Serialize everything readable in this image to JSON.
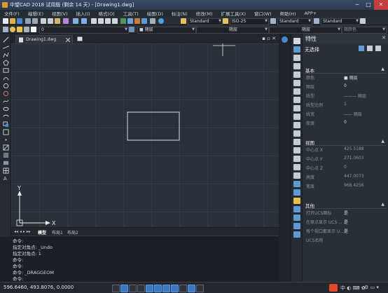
{
  "window": {
    "title": "中望CAD 2018 试用版 (剩余 14 天) - [Drawing1.dwg]",
    "minimize": "─",
    "maximize": "□",
    "close": "✕"
  },
  "menu": [
    "文件(F)",
    "编辑(E)",
    "视图(V)",
    "插入(I)",
    "格式(O)",
    "工具(T)",
    "绘图(D)",
    "标注(N)",
    "修改(M)",
    "扩展工具(X)",
    "窗口(W)",
    "帮助(H)",
    "APP+"
  ],
  "toolbar": {
    "text_style": "Standard",
    "dim_style": "ISO-25",
    "table_style": "Standard",
    "multileader_style": "Standard",
    "layer": "0",
    "color": "■ 随层",
    "linetype": "随层",
    "lineweight": "随层",
    "plot_style": "随颜色"
  },
  "document": {
    "tab_label": "Drawing1.dwg"
  },
  "canvas": {
    "axis_x": "X",
    "axis_y": "Y"
  },
  "layout_tabs": {
    "model": "模型",
    "layout1": "布局1",
    "layout2": "布局2"
  },
  "command_history": [
    "命令:",
    "指定对角点: _Undo",
    "指定对角点: 1",
    "命令:",
    "命令:",
    "命令: _DRAGGEOM",
    "命令:"
  ],
  "properties": {
    "panel_title": "特性",
    "selection": "无选择",
    "sections": [
      {
        "title": "基本",
        "rows": [
          {
            "key": "颜色",
            "value": "■ 随层",
            "active": true
          },
          {
            "key": "图层",
            "value": "0",
            "active": true
          },
          {
            "key": "线型",
            "value": "——— 随层",
            "active": false
          },
          {
            "key": "线型比例",
            "value": "1",
            "active": false
          },
          {
            "key": "线宽",
            "value": "—— 随层",
            "active": false
          },
          {
            "key": "厚度",
            "value": "0",
            "active": true
          }
        ]
      },
      {
        "title": "视图",
        "rows": [
          {
            "key": "中心点 X",
            "value": "425.5188",
            "active": false
          },
          {
            "key": "中心点 Y",
            "value": "271.0603",
            "active": false
          },
          {
            "key": "中心点 Z",
            "value": "0",
            "active": false
          },
          {
            "key": "高度",
            "value": "447.0073",
            "active": false
          },
          {
            "key": "宽度",
            "value": "968.4256",
            "active": false
          }
        ]
      },
      {
        "title": "其他",
        "rows": [
          {
            "key": "打开UCS图标",
            "value": "是",
            "active": true
          },
          {
            "key": "在原点显示 UCS ...",
            "value": "是",
            "active": true
          },
          {
            "key": "每个视口都显示 U...",
            "value": "是",
            "active": true
          },
          {
            "key": "UCS名称",
            "value": "",
            "active": false
          }
        ]
      }
    ]
  },
  "status": {
    "coordinates": "596.6460, 493.8076, 0.0000"
  },
  "colors": {
    "accent": "#3a78c2",
    "canvas": "#2a3038",
    "rectangle": "#d8dde4"
  }
}
